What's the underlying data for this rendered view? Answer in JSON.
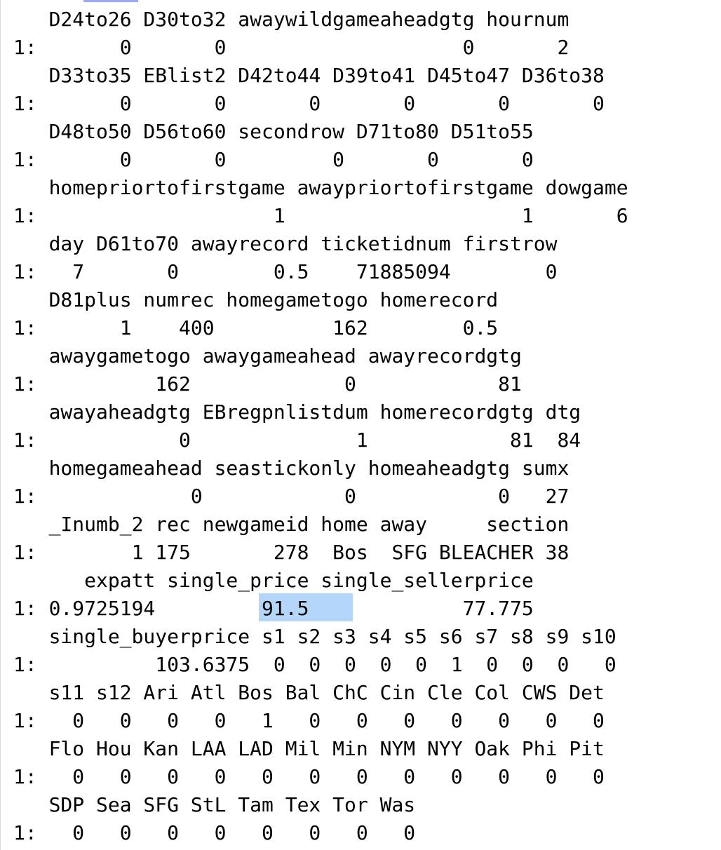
{
  "console": {
    "lines": [
      "   D24to26 D30to32 awaywildgameaheadgtg hournum",
      "1:       0       0                    0       2",
      "   D33to35 EBlist2 D42to44 D39to41 D45to47 D36to38",
      "1:       0       0       0       0       0       0",
      "   D48to50 D56to60 secondrow D71to80 D51to55",
      "1:       0       0         0       0       0",
      "   homepriortofirstgame awaypriortofirstgame dowgame",
      "1:                    1                    1       6",
      "   day D61to70 awayrecord ticketidnum firstrow",
      "1:   7       0        0.5    71885094        0",
      "   D81plus numrec homegametogo homerecord",
      "1:       1    400          162        0.5",
      "   awaygametogo awaygameahead awayrecordgtg",
      "1:          162             0            81",
      "   awayaheadgtg EBregpnlistdum homerecordgtg dtg",
      "1:            0              1            81  84",
      "   homegameahead seastickonly homeaheadgtg sumx",
      "1:             0            0            0   27",
      "   _Inumb_2 rec newgameid home away     section",
      "1:        1 175       278  Bos  SFG BLEACHER 38",
      "      expatt single_price single_sellerprice",
      "1: 0.9725194         91.5             77.775",
      "   single_buyerprice s1 s2 s3 s4 s5 s6 s7 s8 s9 s10",
      "1:          103.6375  0  0  0  0  0  1  0  0  0   0",
      "   s11 s12 Ari Atl Bos Bal ChC Cin Cle Col CWS Det",
      "1:   0   0   0   0   1   0   0   0   0   0   0   0",
      "   Flo Hou Kan LAA LAD Mil Min NYM NYY Oak Phi Pit",
      "1:   0   0   0   0   0   0   0   0   0   0   0   0",
      "   SDP Sea SFG StL Tam Tex Tor Was",
      "1:   0   0   0   0   0   0   0   0"
    ],
    "selection_text": "91.5"
  },
  "colors": {
    "background": "#ffffff",
    "text": "#000000",
    "selection": "#b4d6fb"
  }
}
